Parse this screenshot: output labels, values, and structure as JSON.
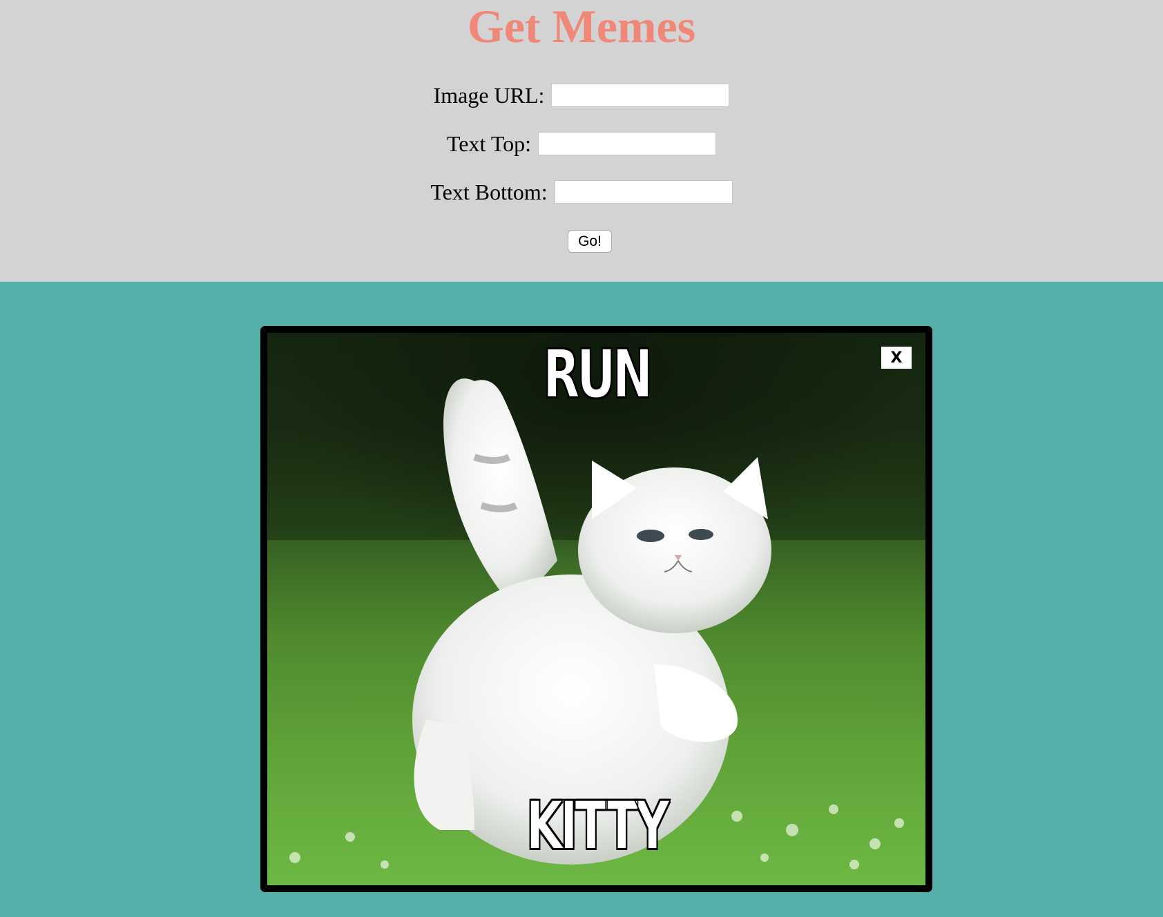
{
  "header": {
    "title": "Get Memes"
  },
  "form": {
    "image_url_label": "Image URL:",
    "text_top_label": "Text Top:",
    "text_bottom_label": "Text Bottom:",
    "image_url_value": "",
    "text_top_value": "",
    "text_bottom_value": "",
    "submit_label": "Go!"
  },
  "meme": {
    "top_text": "RUN",
    "bottom_text": "KITTY",
    "close_label": "X",
    "image_subject": "white-cat-running-in-grass"
  },
  "colors": {
    "header_bg": "#d3d3d3",
    "title": "#ef8878",
    "page_bg": "#55b0aa",
    "card_border": "#000000"
  }
}
